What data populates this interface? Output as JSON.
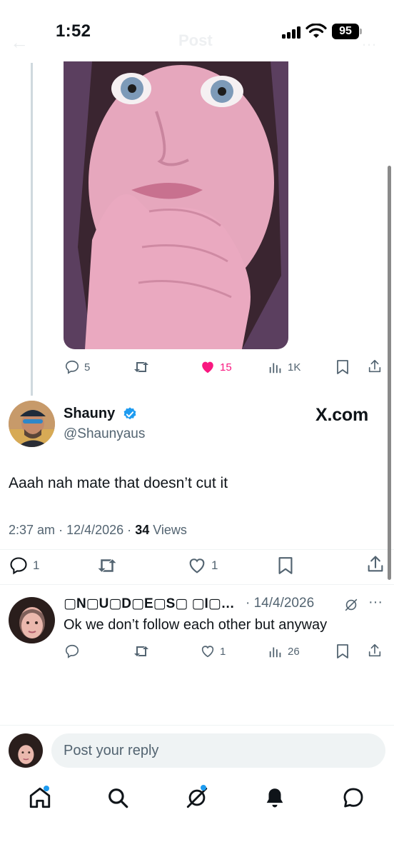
{
  "status_bar": {
    "time": "1:52",
    "battery": "95",
    "ghost_header": "Post"
  },
  "quoted_post": {
    "image_description_icon": "photo",
    "actions": {
      "replies": "5",
      "reposts": "",
      "likes": "15",
      "views": "1K"
    },
    "colors": {
      "liked": "#f91880"
    }
  },
  "main_post": {
    "author_name": "Shauny",
    "author_handle": "@Shaunyaus",
    "watermark": "X.com",
    "text": "Aaah nah mate that doesn’t cut it",
    "time": "2:37 am",
    "date": "12/4/2026",
    "views_count": "34",
    "views_label": "Views",
    "actions": {
      "replies": "1",
      "reposts": "",
      "likes": "1"
    }
  },
  "reply": {
    "author_name": "▢N▢U▢D▢E▢S▢ ▢I▢…",
    "date": "· 14/4/2026",
    "text": "Ok we don’t follow each other but anyway",
    "actions": {
      "replies": "",
      "reposts": "",
      "likes": "1",
      "views": "26"
    }
  },
  "composer": {
    "placeholder": "Post your reply"
  },
  "nav": {
    "items": [
      "home-icon",
      "search-icon",
      "grok-icon",
      "notifications-icon",
      "messages-icon"
    ],
    "accent": "#1d9bf0"
  }
}
